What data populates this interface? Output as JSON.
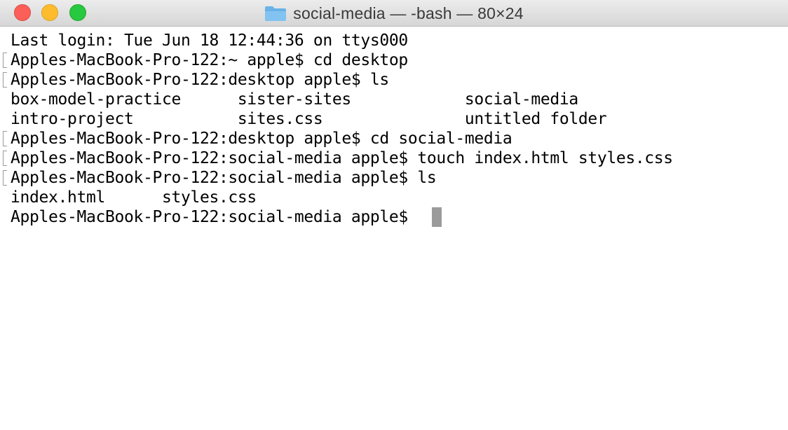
{
  "window": {
    "title": "social-media — -bash — 80×24"
  },
  "terminal": {
    "lines": [
      "Last login: Tue Jun 18 12:44:36 on ttys000",
      "Apples-MacBook-Pro-122:~ apple$ cd desktop",
      "Apples-MacBook-Pro-122:desktop apple$ ls",
      "box-model-practice      sister-sites            social-media",
      "intro-project           sites.css               untitled folder",
      "Apples-MacBook-Pro-122:desktop apple$ cd social-media",
      "Apples-MacBook-Pro-122:social-media apple$ touch index.html styles.css",
      "Apples-MacBook-Pro-122:social-media apple$ ls",
      "index.html      styles.css",
      "Apples-MacBook-Pro-122:social-media apple$ "
    ]
  },
  "icons": {
    "close": "close-button",
    "minimize": "minimize-button",
    "zoom": "zoom-button",
    "folder": "folder-icon"
  },
  "colors": {
    "close": "#fc5f57",
    "minimize": "#fdbc2e",
    "zoom": "#28c840",
    "folder": "#6ab4ea",
    "cursor": "#9b9b9b"
  }
}
